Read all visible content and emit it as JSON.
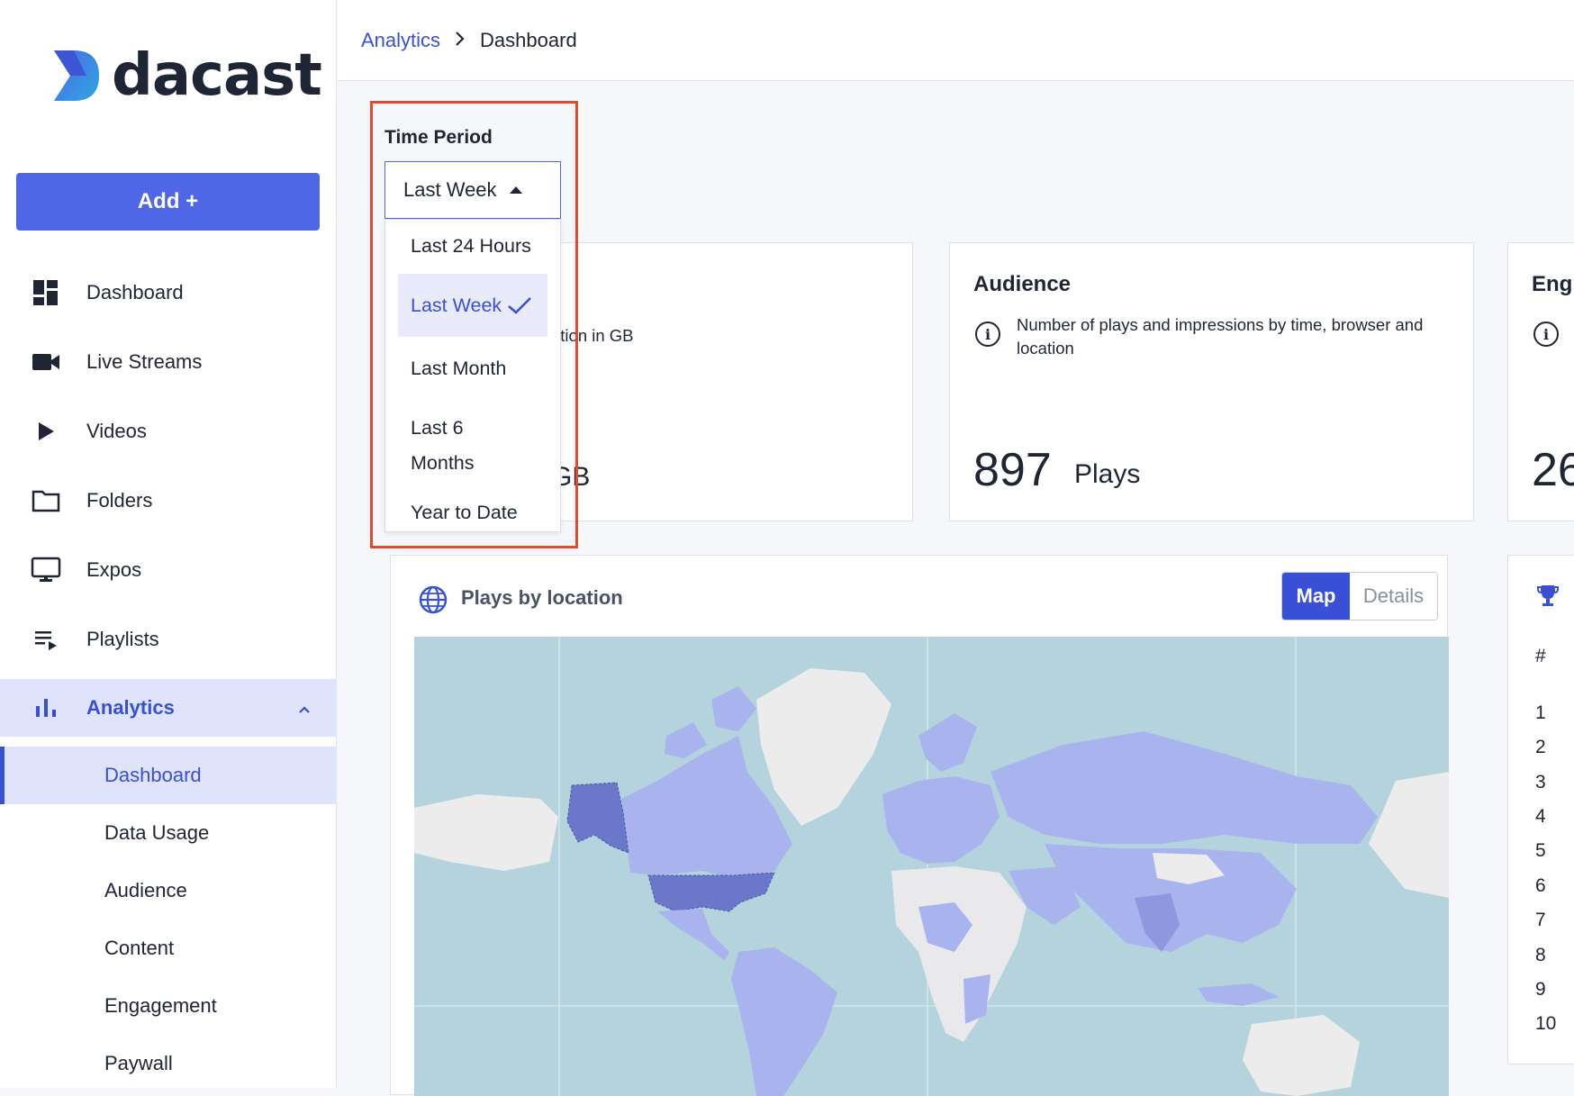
{
  "brand": {
    "name": "dacast"
  },
  "sidebar": {
    "add_label": "Add +",
    "items": [
      {
        "label": "Dashboard",
        "icon": "dashboard-icon"
      },
      {
        "label": "Live Streams",
        "icon": "video-camera-icon"
      },
      {
        "label": "Videos",
        "icon": "play-icon"
      },
      {
        "label": "Folders",
        "icon": "folder-icon"
      },
      {
        "label": "Expos",
        "icon": "monitor-icon"
      },
      {
        "label": "Playlists",
        "icon": "playlist-icon"
      },
      {
        "label": "Analytics",
        "icon": "bar-chart-icon"
      }
    ],
    "analytics_sub": [
      "Dashboard",
      "Data Usage",
      "Audience",
      "Content",
      "Engagement",
      "Paywall"
    ]
  },
  "breadcrumb": {
    "parent": "Analytics",
    "current": "Dashboard"
  },
  "time_period": {
    "label": "Time Period",
    "selected": "Last Week",
    "options": [
      "Last 24 Hours",
      "Last Week",
      "Last Month",
      "Last 6",
      "Months",
      "Year to Date"
    ]
  },
  "cards": {
    "data": {
      "desc_partial": "ption in GB",
      "unit_partial": "GB"
    },
    "audience": {
      "title": "Audience",
      "desc_line1": "Number of plays and impressions by time, browser and",
      "desc_line2": "location",
      "value": "897",
      "unit": "Plays"
    },
    "engagement": {
      "title_partial": "Eng",
      "value_partial": "26"
    }
  },
  "map": {
    "title": "Plays by location",
    "toggle_map": "Map",
    "toggle_details": "Details"
  },
  "ranking": {
    "header": "#",
    "rows": [
      "1",
      "2",
      "3",
      "4",
      "5",
      "6",
      "7",
      "8",
      "9",
      "10"
    ]
  },
  "colors": {
    "accent": "#3950d6",
    "button": "#4f67e6",
    "highlight": "#e64a2e",
    "map_water": "#b5d3dd",
    "country_low": "#a9b3ee",
    "country_high": "#6b77c9"
  }
}
